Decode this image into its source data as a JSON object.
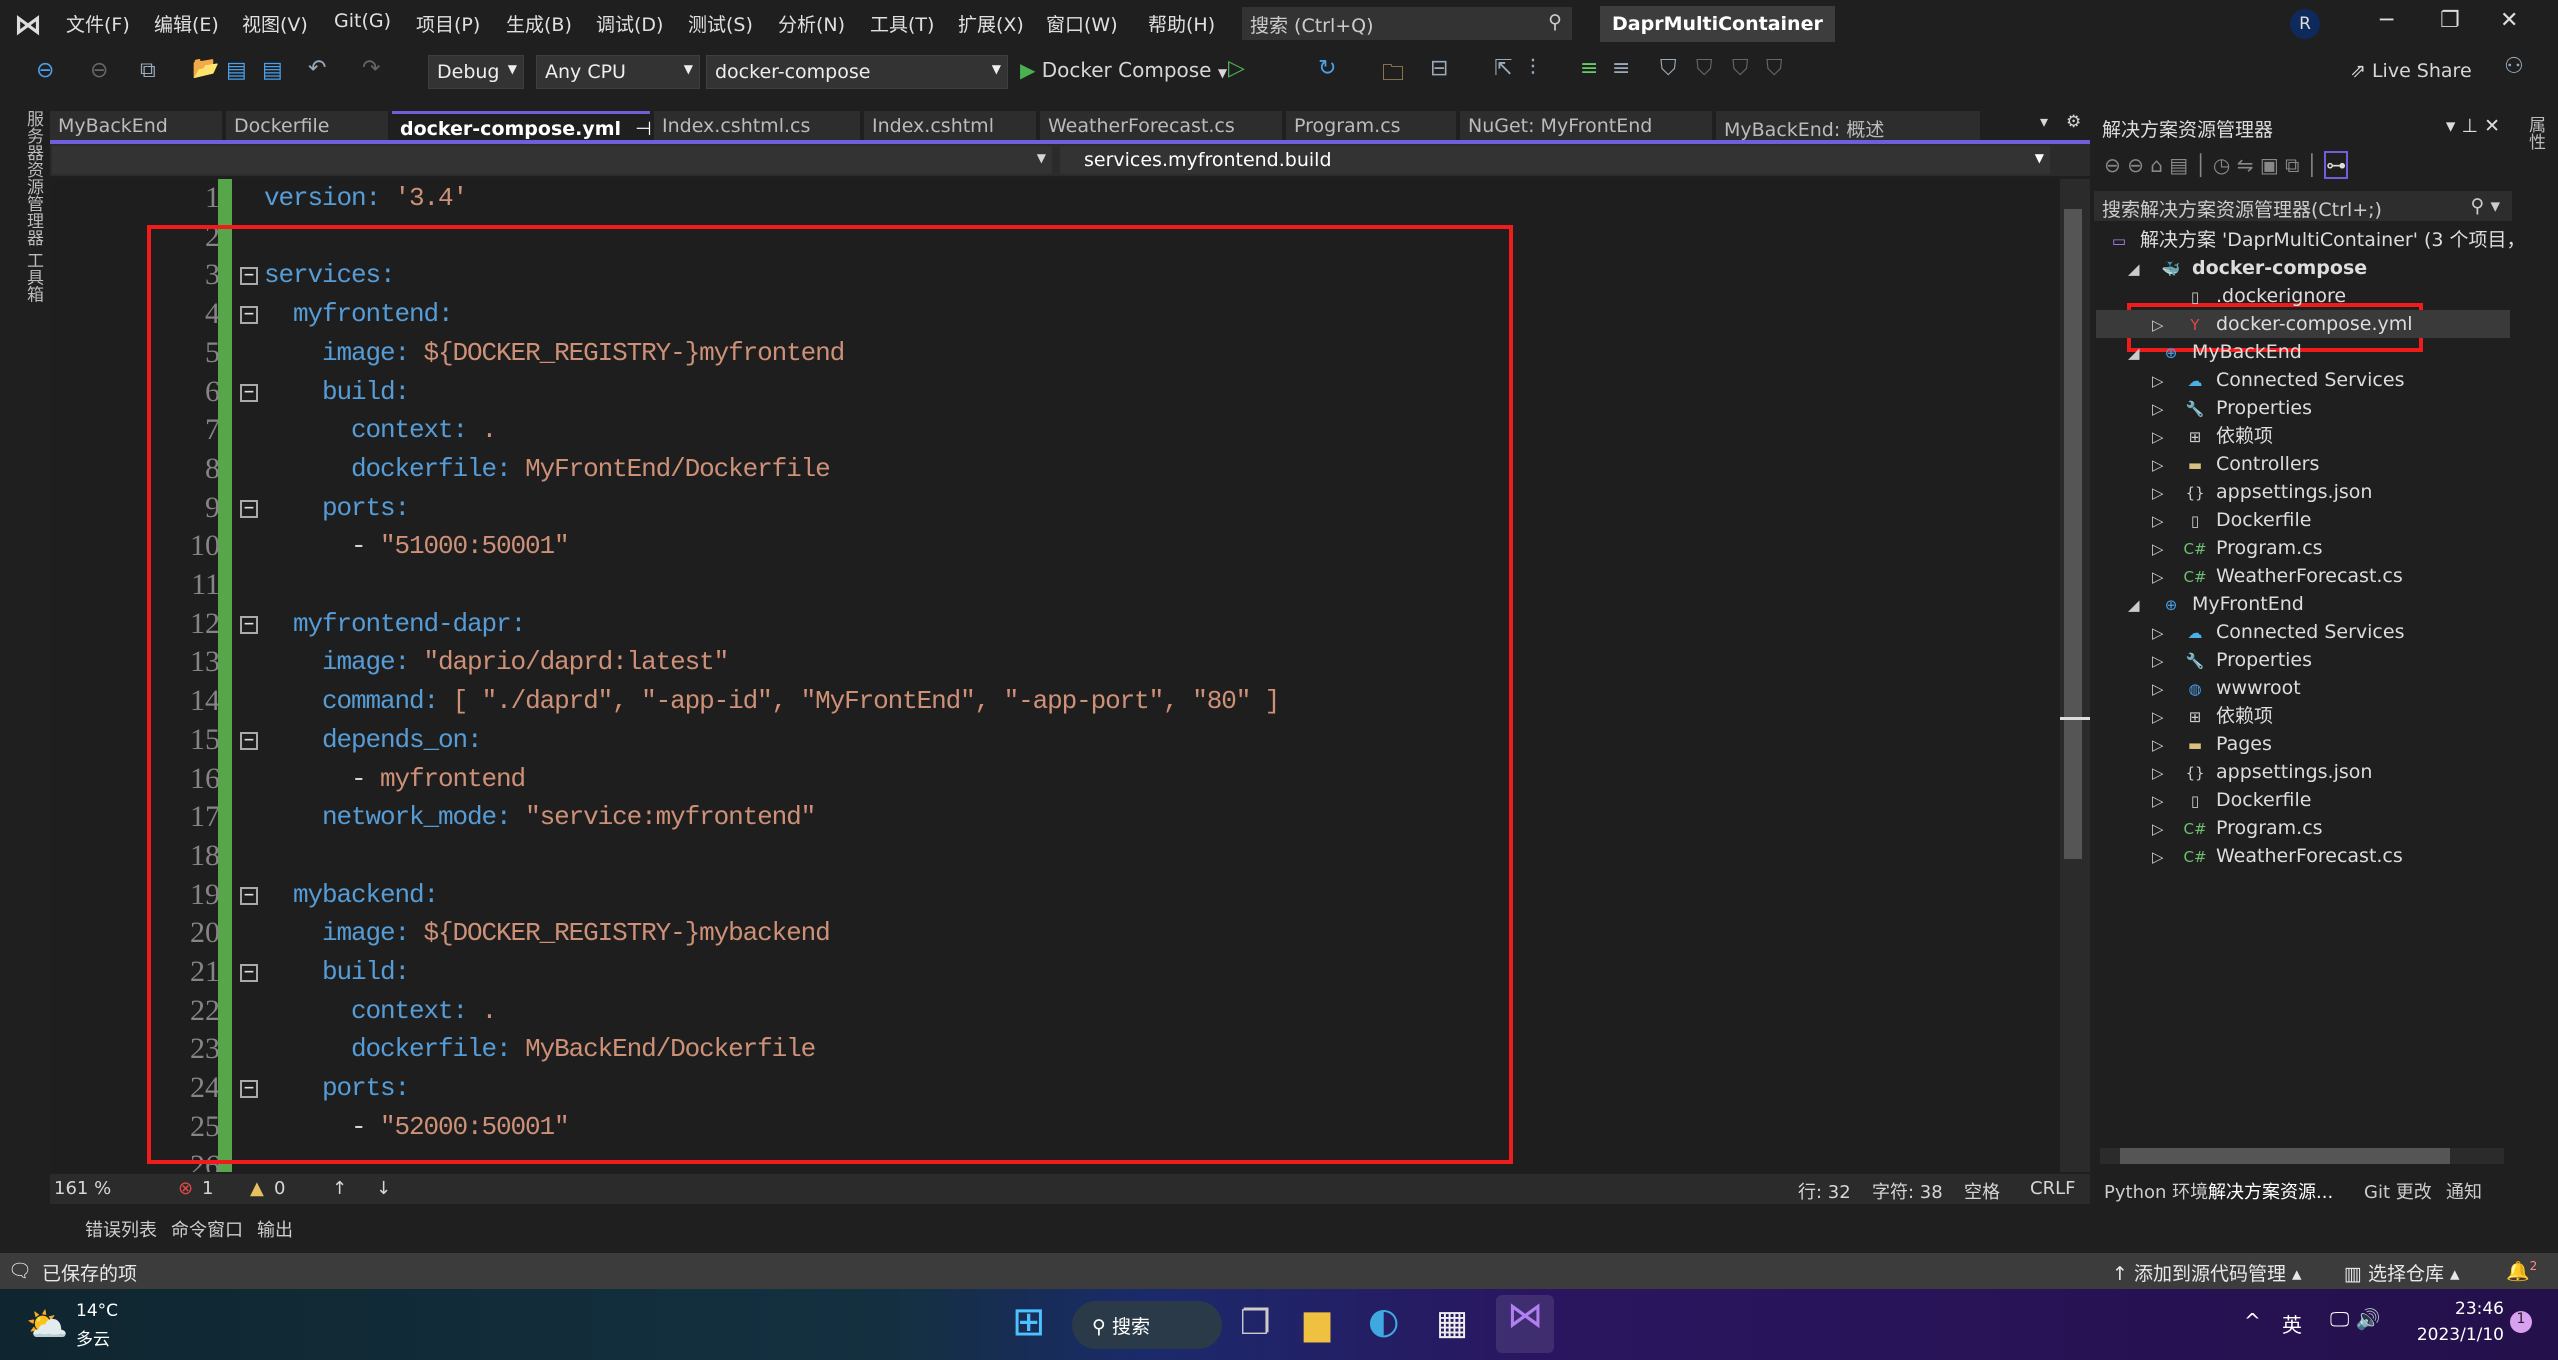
{
  "titlebar": {
    "menus": [
      "文件(F)",
      "编辑(E)",
      "视图(V)",
      "Git(G)",
      "项目(P)",
      "生成(B)",
      "调试(D)",
      "测试(S)",
      "分析(N)",
      "工具(T)",
      "扩展(X)",
      "窗口(W)",
      "帮助(H)"
    ],
    "search_placeholder": "搜索 (Ctrl+Q)",
    "solution_name": "DaprMultiContainer",
    "avatar": "R"
  },
  "toolbar": {
    "config": "Debug",
    "platform": "Any CPU",
    "startup": "docker-compose",
    "run_label": "Docker Compose",
    "live_share": "Live Share"
  },
  "left_strip": "服务器资源管理器  工具箱",
  "right_strip": "属性",
  "tabs": [
    "MyBackEnd",
    "Dockerfile",
    "docker-compose.yml",
    "Index.cshtml.cs",
    "Index.cshtml",
    "WeatherForecast.cs",
    "Program.cs",
    "NuGet: MyFrontEnd",
    "MyBackEnd: 概述"
  ],
  "active_tab": "docker-compose.yml",
  "navbar": {
    "right": "services.myfrontend.build"
  },
  "code": [
    {
      "n": "1",
      "i": 0,
      "k": "version",
      "v": "'3.4'"
    },
    {
      "n": "2",
      "i": 0
    },
    {
      "n": "3",
      "i": 0,
      "k": "services",
      "fold": true
    },
    {
      "n": "4",
      "i": 1,
      "k": "myfrontend",
      "fold": true
    },
    {
      "n": "5",
      "i": 2,
      "k": "image",
      "v": "${DOCKER_REGISTRY-}myfrontend"
    },
    {
      "n": "6",
      "i": 2,
      "k": "build",
      "fold": true
    },
    {
      "n": "7",
      "i": 3,
      "k": "context",
      "v": "."
    },
    {
      "n": "8",
      "i": 3,
      "k": "dockerfile",
      "v": "MyFrontEnd/Dockerfile"
    },
    {
      "n": "9",
      "i": 2,
      "k": "ports",
      "fold": true
    },
    {
      "n": "10",
      "i": 3,
      "d": "- ",
      "v": "\"51000:50001\""
    },
    {
      "n": "11",
      "i": 0
    },
    {
      "n": "12",
      "i": 1,
      "k": "myfrontend-dapr",
      "fold": true
    },
    {
      "n": "13",
      "i": 2,
      "k": "image",
      "v": "\"daprio/daprd:latest\""
    },
    {
      "n": "14",
      "i": 2,
      "k": "command",
      "v": "[ \"./daprd\", \"-app-id\", \"MyFrontEnd\", \"-app-port\", \"80\" ]"
    },
    {
      "n": "15",
      "i": 2,
      "k": "depends_on",
      "fold": true
    },
    {
      "n": "16",
      "i": 3,
      "d": "- ",
      "v": "myfrontend"
    },
    {
      "n": "17",
      "i": 2,
      "k": "network_mode",
      "v": "\"service:myfrontend\""
    },
    {
      "n": "18",
      "i": 0
    },
    {
      "n": "19",
      "i": 1,
      "k": "mybackend",
      "fold": true
    },
    {
      "n": "20",
      "i": 2,
      "k": "image",
      "v": "${DOCKER_REGISTRY-}mybackend"
    },
    {
      "n": "21",
      "i": 2,
      "k": "build",
      "fold": true
    },
    {
      "n": "22",
      "i": 3,
      "k": "context",
      "v": "."
    },
    {
      "n": "23",
      "i": 3,
      "k": "dockerfile",
      "v": "MyBackEnd/Dockerfile"
    },
    {
      "n": "24",
      "i": 2,
      "k": "ports",
      "fold": true
    },
    {
      "n": "25",
      "i": 3,
      "d": "- ",
      "v": "\"52000:50001\""
    },
    {
      "n": "26",
      "i": 0
    }
  ],
  "editor_status": {
    "zoom": "161 %",
    "errors": "1",
    "warnings": "0",
    "line": "行: 32",
    "col": "字符: 38",
    "spaces": "空格",
    "eol": "CRLF"
  },
  "bottom_tabs": [
    "错误列表",
    "命令窗口",
    "输出"
  ],
  "solution_explorer": {
    "title": "解决方案资源管理器",
    "search": "搜索解决方案资源管理器(Ctrl+;)",
    "items": [
      {
        "label": "解决方案 'DaprMultiContainer' (3 个项目，",
        "lvl": 0,
        "exp": "",
        "icon": "solution-icon"
      },
      {
        "label": "docker-compose",
        "lvl": 1,
        "exp": "open",
        "icon": "docker-icon",
        "bold": true
      },
      {
        "label": ".dockerignore",
        "lvl": 2,
        "exp": "",
        "icon": "file-icon"
      },
      {
        "label": "docker-compose.yml",
        "lvl": 2,
        "exp": "closed",
        "icon": "yml-file-icon",
        "selected": true
      },
      {
        "label": "MyBackEnd",
        "lvl": 1,
        "exp": "open",
        "icon": "web-project-icon"
      },
      {
        "label": "Connected Services",
        "lvl": 2,
        "exp": "closed",
        "icon": "connected-services-icon"
      },
      {
        "label": "Properties",
        "lvl": 2,
        "exp": "closed",
        "icon": "properties-icon"
      },
      {
        "label": "依赖项",
        "lvl": 2,
        "exp": "closed",
        "icon": "dependencies-icon"
      },
      {
        "label": "Controllers",
        "lvl": 2,
        "exp": "closed",
        "icon": "folder-icon"
      },
      {
        "label": "appsettings.json",
        "lvl": 2,
        "exp": "closed",
        "icon": "json-file-icon"
      },
      {
        "label": "Dockerfile",
        "lvl": 2,
        "exp": "closed",
        "icon": "file-icon"
      },
      {
        "label": "Program.cs",
        "lvl": 2,
        "exp": "closed",
        "icon": "csharp-file-icon"
      },
      {
        "label": "WeatherForecast.cs",
        "lvl": 2,
        "exp": "closed",
        "icon": "csharp-file-icon"
      },
      {
        "label": "MyFrontEnd",
        "lvl": 1,
        "exp": "open",
        "icon": "web-project-icon"
      },
      {
        "label": "Connected Services",
        "lvl": 2,
        "exp": "closed",
        "icon": "connected-services-icon"
      },
      {
        "label": "Properties",
        "lvl": 2,
        "exp": "closed",
        "icon": "properties-icon"
      },
      {
        "label": "wwwroot",
        "lvl": 2,
        "exp": "closed",
        "icon": "globe-icon"
      },
      {
        "label": "依赖项",
        "lvl": 2,
        "exp": "closed",
        "icon": "dependencies-icon"
      },
      {
        "label": "Pages",
        "lvl": 2,
        "exp": "closed",
        "icon": "folder-icon"
      },
      {
        "label": "appsettings.json",
        "lvl": 2,
        "exp": "closed",
        "icon": "json-file-icon"
      },
      {
        "label": "Dockerfile",
        "lvl": 2,
        "exp": "closed",
        "icon": "file-icon"
      },
      {
        "label": "Program.cs",
        "lvl": 2,
        "exp": "closed",
        "icon": "csharp-file-icon"
      },
      {
        "label": "WeatherForecast.cs",
        "lvl": 2,
        "exp": "closed",
        "icon": "csharp-file-icon"
      }
    ],
    "bottom_tabs": [
      "Python 环境",
      "解决方案资源...",
      "Git 更改",
      "通知"
    ]
  },
  "statusbar": {
    "saved": "已保存的项",
    "add_source": "添加到源代码管理",
    "select_repo": "选择仓库",
    "notifications": "2"
  },
  "taskbar": {
    "temp": "14°C",
    "weather": "多云",
    "search": "搜索",
    "ime": "英",
    "time": "23:46",
    "date": "2023/1/10",
    "badge": "1"
  },
  "colors": {
    "accent": "#6f5fd8",
    "key": "#569cd6",
    "value": "#ce9178",
    "highlight": "#f01c1c"
  }
}
